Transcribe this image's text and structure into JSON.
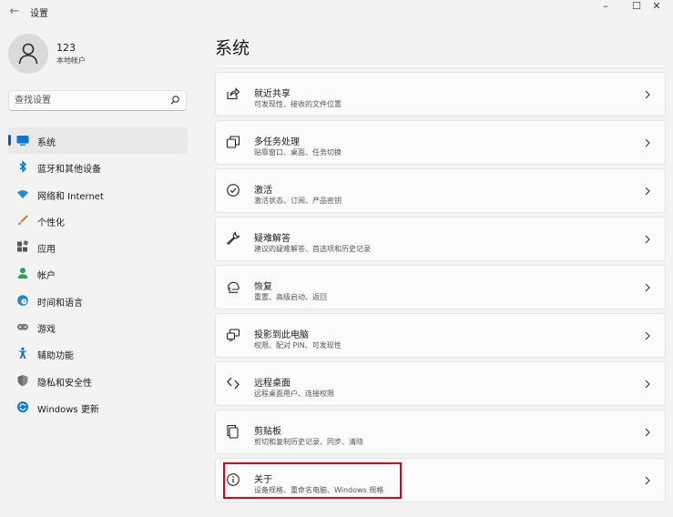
{
  "window": {
    "title": "设置",
    "minimize_glyph": "–",
    "maximize_glyph": "☐",
    "close_glyph": "✕"
  },
  "user": {
    "name": "123",
    "account_type": "本地帐户"
  },
  "search": {
    "placeholder": "查找设置"
  },
  "nav": [
    {
      "label": "系统",
      "icon": "system-icon",
      "color": "#0078d4",
      "selected": true
    },
    {
      "label": "蓝牙和其他设备",
      "icon": "bluetooth-icon",
      "color": "#0078d4"
    },
    {
      "label": "网络和 Internet",
      "icon": "wifi-icon",
      "color": "#1e90e0"
    },
    {
      "label": "个性化",
      "icon": "brush-icon",
      "color": "#d5832a"
    },
    {
      "label": "应用",
      "icon": "apps-icon",
      "color": "#555555"
    },
    {
      "label": "帐户",
      "icon": "account-icon",
      "color": "#2ea05a"
    },
    {
      "label": "时间和语言",
      "icon": "clock-globe-icon",
      "color": "#1e88c8"
    },
    {
      "label": "游戏",
      "icon": "gamepad-icon",
      "color": "#777777"
    },
    {
      "label": "辅助功能",
      "icon": "accessibility-icon",
      "color": "#1a6fc2"
    },
    {
      "label": "隐私和安全性",
      "icon": "shield-icon",
      "color": "#6b6b6b"
    },
    {
      "label": "Windows 更新",
      "icon": "windows-update-icon",
      "color": "#0a7bd6"
    }
  ],
  "page": {
    "title": "系统"
  },
  "cards": [
    {
      "title": "就近共享",
      "subtitle": "可发现性、接收的文件位置",
      "icon": "share-icon"
    },
    {
      "title": "多任务处理",
      "subtitle": "贴靠窗口、桌面、任务切换",
      "icon": "multitask-icon"
    },
    {
      "title": "激活",
      "subtitle": "激活状态、订阅、产品密钥",
      "icon": "check-circle-icon"
    },
    {
      "title": "疑难解答",
      "subtitle": "建议的疑难解答、首选项和历史记录",
      "icon": "wrench-icon"
    },
    {
      "title": "恢复",
      "subtitle": "重置、高级启动、返回",
      "icon": "recovery-icon"
    },
    {
      "title": "投影到此电脑",
      "subtitle": "权限、配对 PIN、可发现性",
      "icon": "project-icon"
    },
    {
      "title": "远程桌面",
      "subtitle": "远程桌面用户、连接权限",
      "icon": "remote-desktop-icon"
    },
    {
      "title": "剪贴板",
      "subtitle": "剪切和复制历史记录、同步、清除",
      "icon": "clipboard-icon"
    },
    {
      "title": "关于",
      "subtitle": "设备规格、重命名电脑、Windows 规格",
      "icon": "info-icon"
    }
  ],
  "colors": {
    "accent": "#005fb8",
    "highlight_box": "#e0001b"
  }
}
